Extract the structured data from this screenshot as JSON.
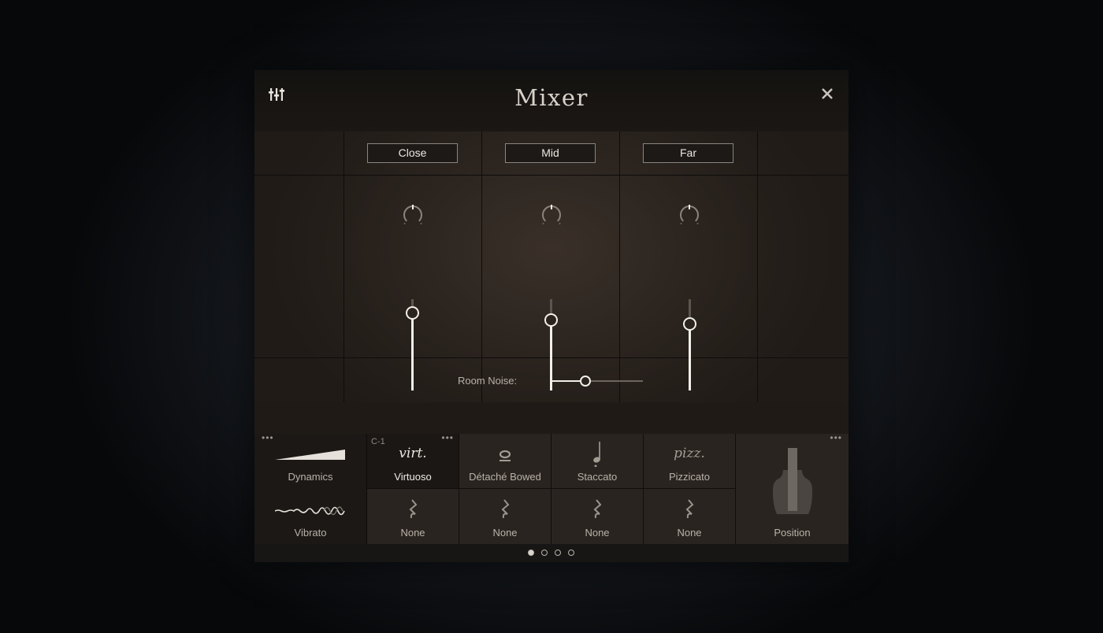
{
  "header": {
    "title": "Mixer"
  },
  "channels": [
    {
      "label": "Close",
      "level": 0.85
    },
    {
      "label": "Mid",
      "level": 0.78
    },
    {
      "label": "Far",
      "level": 0.73
    }
  ],
  "room_noise": {
    "label": "Room Noise:",
    "value": 0.38
  },
  "left_controls": {
    "dynamics_label": "Dynamics",
    "vibrato_label": "Vibrato"
  },
  "articulations": {
    "row1": [
      {
        "key": "C-1",
        "glyph": "virt.",
        "label": "Virtuoso",
        "active": true
      },
      {
        "glyph": "",
        "label": "Détaché Bowed",
        "active": false
      },
      {
        "glyph": "",
        "label": "Staccato",
        "active": false
      },
      {
        "glyph": "pizz.",
        "label": "Pizzicato",
        "active": false
      }
    ],
    "row2": [
      {
        "label": "None"
      },
      {
        "label": "None"
      },
      {
        "label": "None"
      },
      {
        "label": "None"
      }
    ]
  },
  "position": {
    "label": "Position"
  },
  "pager": {
    "count": 4,
    "current": 0
  },
  "colors": {
    "accent": "#f2efe9",
    "panel": "#171412",
    "cell": "#2a2420"
  }
}
